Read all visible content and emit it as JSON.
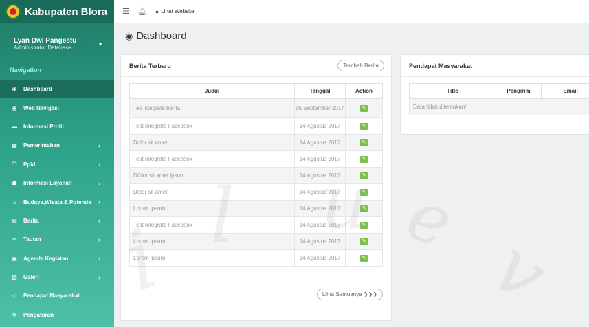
{
  "brand": {
    "title": "Kabupaten Blora"
  },
  "user": {
    "name": "Lyan Dwi Pangestu",
    "role": "Administrator Database"
  },
  "nav": {
    "heading": "Navigation",
    "items": [
      {
        "label": "Dashboard",
        "icon": "dashboard-icon",
        "glyph": "◉",
        "active": true,
        "chevron": false
      },
      {
        "label": "Web Navigasi",
        "icon": "compass-icon",
        "glyph": "◉",
        "active": false,
        "chevron": false
      },
      {
        "label": "Informasi Profil",
        "icon": "folder-icon",
        "glyph": "▬",
        "active": false,
        "chevron": false
      },
      {
        "label": "Pemerintahan",
        "icon": "building-icon",
        "glyph": "▦",
        "active": false,
        "chevron": true
      },
      {
        "label": "Ppid",
        "icon": "copy-icon",
        "glyph": "❐",
        "active": false,
        "chevron": true
      },
      {
        "label": "Informasi Layanan",
        "icon": "users-icon",
        "glyph": "☗",
        "active": false,
        "chevron": true
      },
      {
        "label": "Budaya,Wisata & Potenda",
        "icon": "institution-icon",
        "glyph": "⌂",
        "active": false,
        "chevron": true
      },
      {
        "label": "Berita",
        "icon": "newspaper-icon",
        "glyph": "▤",
        "active": false,
        "chevron": true
      },
      {
        "label": "Tautan",
        "icon": "link-icon",
        "glyph": "∞",
        "active": false,
        "chevron": true
      },
      {
        "label": "Agenda Kegiatan",
        "icon": "calendar-icon",
        "glyph": "▣",
        "active": false,
        "chevron": true
      },
      {
        "label": "Galeri",
        "icon": "image-icon",
        "glyph": "▨",
        "active": false,
        "chevron": true
      },
      {
        "label": "Pendapat Masyarakat",
        "icon": "bullhorn-icon",
        "glyph": "◁",
        "active": false,
        "chevron": false
      },
      {
        "label": "Pengaturan",
        "icon": "gears-icon",
        "glyph": "✲",
        "active": false,
        "chevron": false
      }
    ]
  },
  "topbar": {
    "website_link": "Lihat Website"
  },
  "page": {
    "title": "Dashboard"
  },
  "berita": {
    "title": "Berita Terbaru",
    "add_button": "Tambah Berita",
    "columns": [
      "Judul",
      "Tanggal",
      "Action"
    ],
    "rows": [
      {
        "judul": "Tes integrate berita",
        "tanggal": "05 September 2017"
      },
      {
        "judul": "Test Integrate Facebook",
        "tanggal": "14 Agustus 2017"
      },
      {
        "judul": "Dolor sit amet",
        "tanggal": "14 Agustus 2017"
      },
      {
        "judul": "Test Integrate Facebook",
        "tanggal": "14 Agustus 2017"
      },
      {
        "judul": "DOlor sit amet ipsum",
        "tanggal": "14 Agustus 2017"
      },
      {
        "judul": "Dolor sit amet",
        "tanggal": "14 Agustus 2017"
      },
      {
        "judul": "Lorem ipsum",
        "tanggal": "14 Agustus 2017"
      },
      {
        "judul": "Test Integrate Facebook",
        "tanggal": "14 Agustus 2017"
      },
      {
        "judul": "Lorem ipsum",
        "tanggal": "14 Agustus 2017"
      },
      {
        "judul": "Lorem ipsum",
        "tanggal": "14 Agustus 2017"
      }
    ],
    "view_all": "Lihat Semuanya ❯❯❯"
  },
  "pendapat": {
    "title": "Pendapat Masyarakat",
    "columns": [
      "Title",
      "Pengirim",
      "Email"
    ],
    "empty": "Data tidak ditemukan!"
  }
}
